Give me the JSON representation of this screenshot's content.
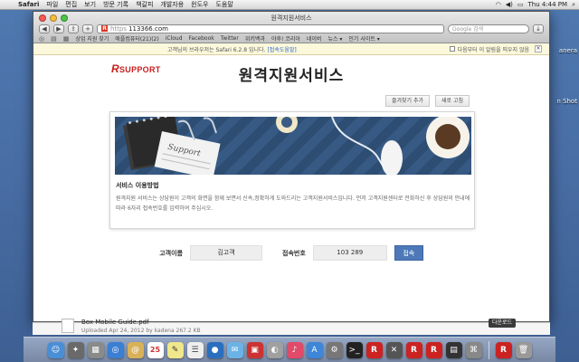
{
  "menubar": {
    "app_name": "Safari",
    "menus": [
      "파일",
      "편집",
      "보기",
      "방문 기록",
      "책갈피",
      "개발자용",
      "윈도우",
      "도움말"
    ],
    "clock": "Thu 4:44 PM"
  },
  "desktop": {
    "right_label_1": "anera",
    "right_label_2": "n Shot"
  },
  "window": {
    "title": "원격지원서비스",
    "url_scheme": "https",
    "url": "113366.com",
    "search_placeholder": "Google 검색",
    "bookmarks": [
      "상업 지원 찾기",
      "애플컴퓨터(21)(2)",
      "iCloud",
      "Facebook",
      "Twitter",
      "위키백과",
      "야후! 코리아",
      "네이버",
      "뉴스 ▾",
      "인기 사이트 ▾"
    ]
  },
  "notice": {
    "text": "고객님의 브라우저는 Safari 6.2.8 입니다.",
    "link": "[접속도움말]",
    "dont_show": "다음부터 이 알림을 띄우지 않음"
  },
  "page": {
    "logo": "SUPPORT",
    "logo_r": "R",
    "title": "원격지원서비스",
    "bookmark_btn": "즐겨찾기 추가",
    "refresh_btn": "새로 고침",
    "banner_note": "Support",
    "card_title": "서비스 이용방법",
    "card_desc": "원격지원 서비스는 상담원이 고객의 화면을 함께 보면서 신속,정확하게 도와드리는 고객지원서비스입니다. 먼저 고객지원센터로 전화하신 후 상담원의 안내에 따라 6자리 접속번호를 입력하여 주십시오.",
    "name_label": "고객이름",
    "name_value": "김고객",
    "code_label": "접속번호",
    "code_value": "103 289",
    "connect_btn": "접속"
  },
  "finder": {
    "file_name": "Box Mobile Guide.pdf",
    "file_meta": "Uploaded Apr 24, 2012 by kadena   267.2 KB",
    "download_btn": "다운로드"
  },
  "dock": {
    "calendar_day": "25"
  }
}
